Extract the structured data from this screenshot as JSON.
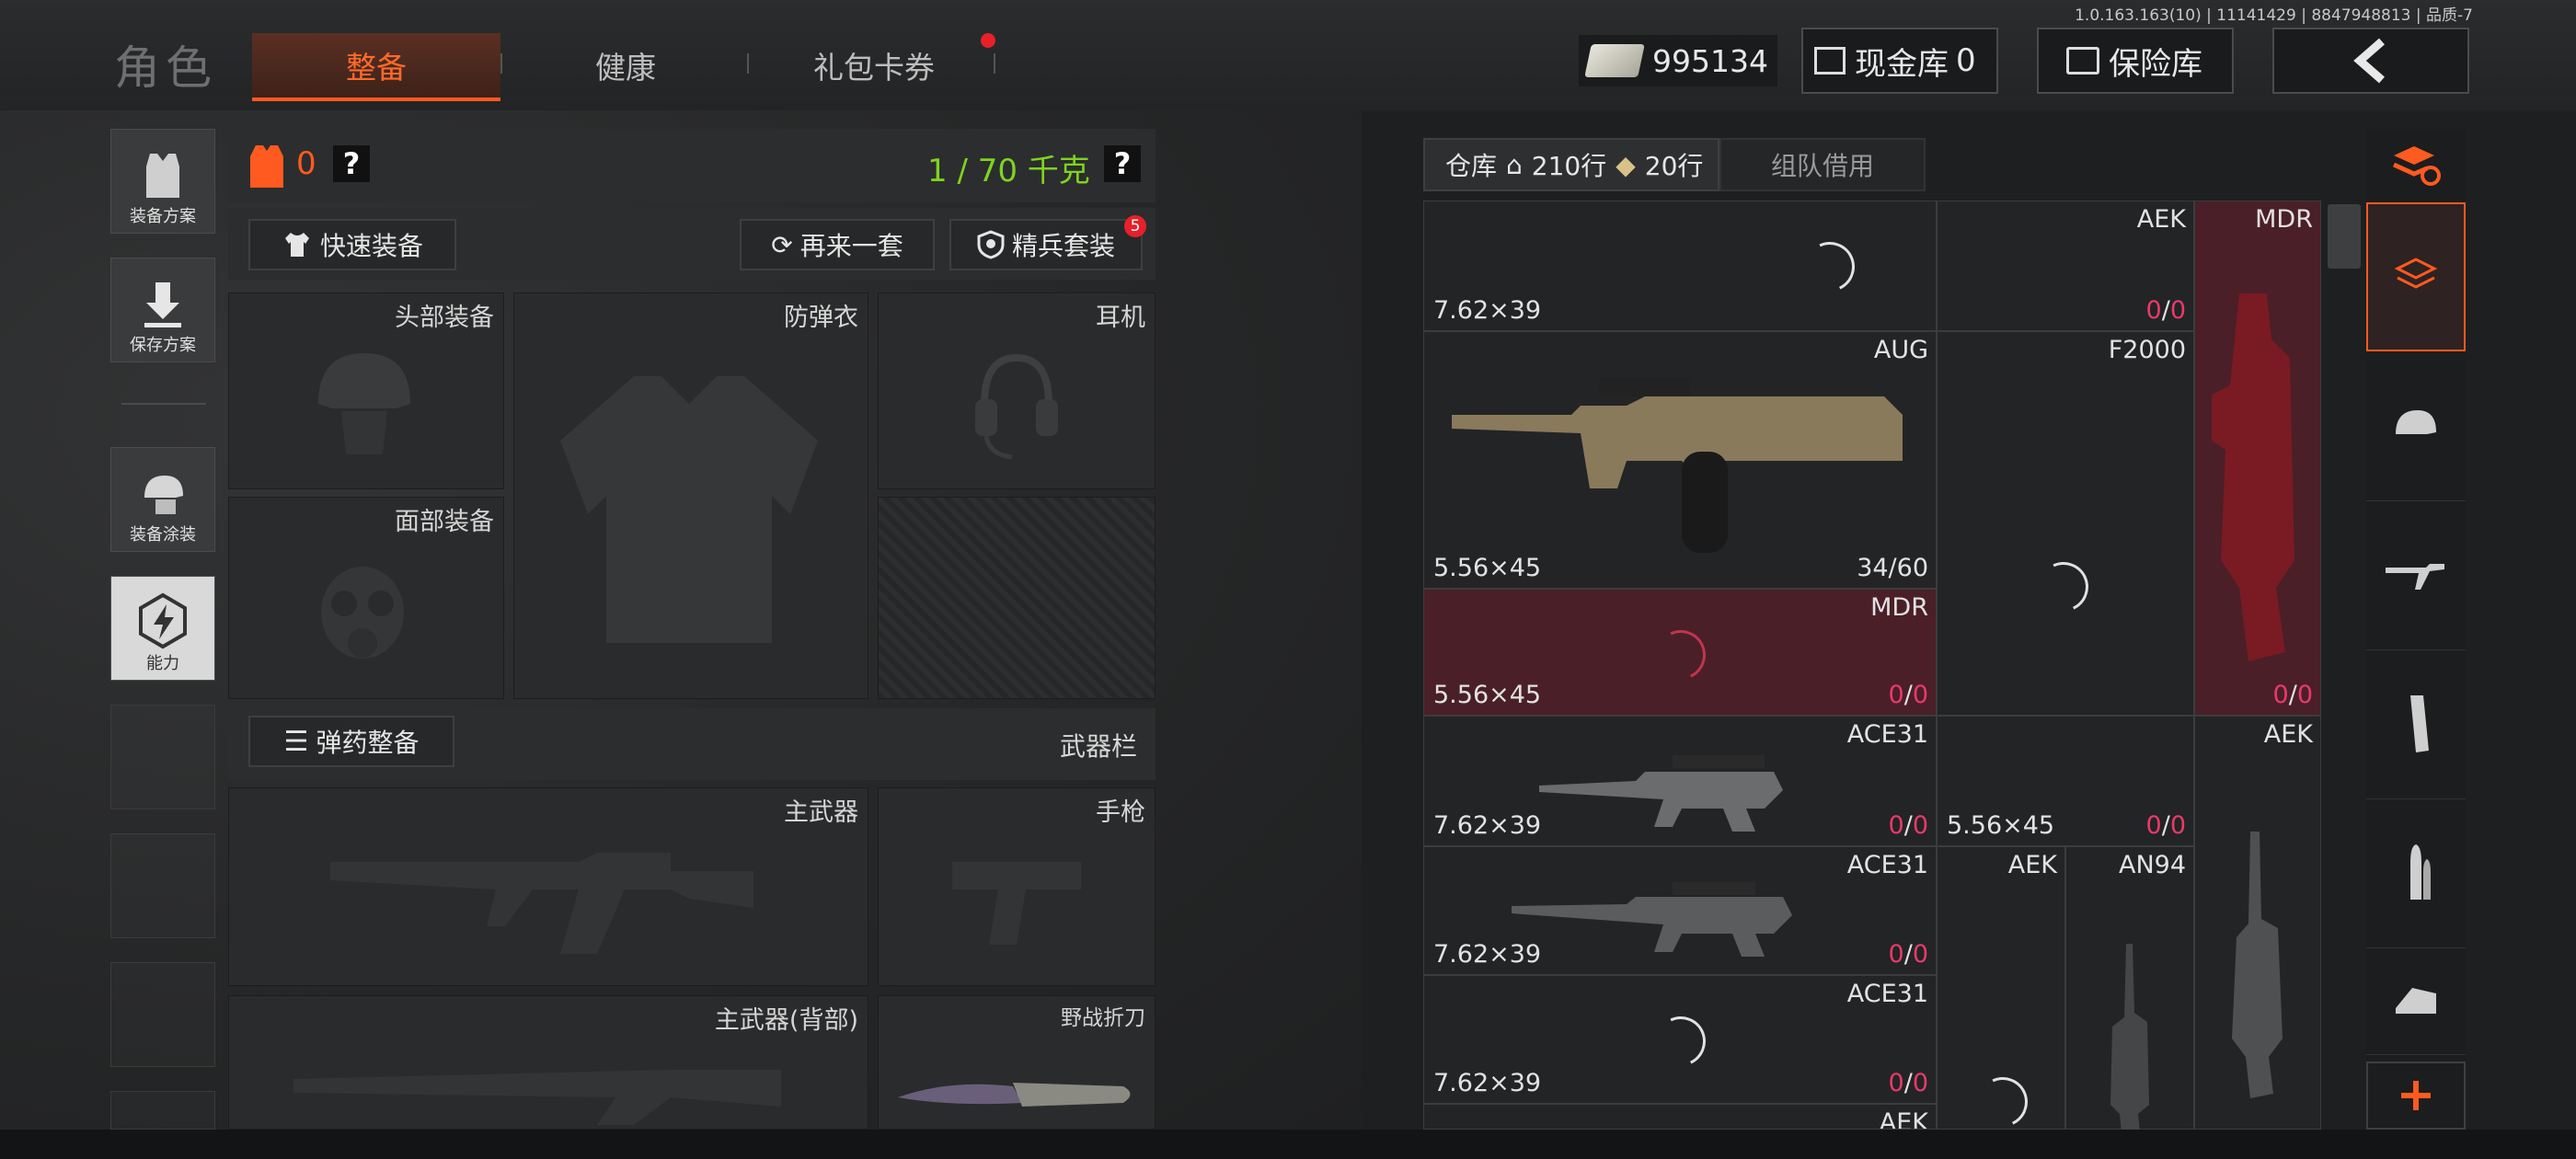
{
  "header": {
    "title": "角色",
    "tabs": [
      {
        "label": "整备",
        "active": true
      },
      {
        "label": "健康",
        "active": false
      },
      {
        "label": "礼包卡券",
        "active": false,
        "badge_dot": true
      }
    ],
    "version": "1.0.163.163(10) | 11141429 | 8847948813 | 品质-7",
    "currency": "995134",
    "cash_vault_label": "现金库",
    "cash_vault_value": "0",
    "insurance_label": "保险库"
  },
  "sidebar": {
    "buttons": [
      {
        "label": "装备方案",
        "icon": "armor-vest-icon"
      },
      {
        "label": "保存方案",
        "icon": "download-icon"
      },
      {
        "label": "装备涂装",
        "icon": "helmet-paint-icon"
      },
      {
        "label": "能力",
        "icon": "lightning-hex-icon"
      }
    ]
  },
  "loadout": {
    "value_count": "0",
    "help1": "?",
    "weight": "1 / 70 千克",
    "help2": "?",
    "quick_equip": "快速装备",
    "again": "再来一套",
    "elite": "精兵套装",
    "elite_badge": "5",
    "slots": {
      "head": "头部装备",
      "armor": "防弹衣",
      "ear": "耳机",
      "face": "面部装备"
    },
    "ammo_button": "弹药整备",
    "weapon_bar": "武器栏",
    "primary": "主武器",
    "pistol": "手枪",
    "primary_back": "主武器(背部)",
    "knife": "野战折刀"
  },
  "warehouse": {
    "tab_label": "仓库",
    "rows1": "210行",
    "rows2": "20行",
    "team_tab": "组队借用",
    "cells": [
      {
        "name": "",
        "caliber": "7.62×39",
        "dur": "",
        "dur_max": ""
      },
      {
        "name": "AEK",
        "caliber": "",
        "dur": "0",
        "dur_max": "0"
      },
      {
        "name": "MDR",
        "caliber": "",
        "dur": "0",
        "dur_max": "0"
      },
      {
        "name": "AUG",
        "caliber": "5.56×45",
        "dur": "34",
        "dur_max": "/60"
      },
      {
        "name": "F2000",
        "caliber": "",
        "dur": "",
        "dur_max": ""
      },
      {
        "name": "MDR",
        "caliber": "5.56×45",
        "dur": "0",
        "dur_max": "0"
      },
      {
        "name": "ACE31",
        "caliber": "7.62×39",
        "dur": "0",
        "dur_max": "0"
      },
      {
        "name": "",
        "caliber": "5.56×45",
        "dur": "0",
        "dur_max": "0"
      },
      {
        "name": "AEK",
        "caliber": "",
        "dur": "",
        "dur_max": ""
      },
      {
        "name": "ACE31",
        "caliber": "7.62×39",
        "dur": "0",
        "dur_max": "0"
      },
      {
        "name": "AEK",
        "caliber": "",
        "dur": "",
        "dur_max": ""
      },
      {
        "name": "AN94",
        "caliber": "",
        "dur": "",
        "dur_max": ""
      },
      {
        "name": "ACE31",
        "caliber": "7.62×39",
        "dur": "0",
        "dur_max": "0"
      },
      {
        "name": "AEK",
        "caliber": "",
        "dur": "",
        "dur_max": ""
      }
    ],
    "right_col_dur": "0"
  },
  "categories": [
    "layers-refresh-icon",
    "stack-icon",
    "helmet-icon",
    "rifle-icon",
    "magazine-icon",
    "bullet-icon",
    "scope-icon",
    "plus-icon"
  ],
  "colors": {
    "accent": "#ff5a1f",
    "green": "#7ed321",
    "red_cell": "#4a1f28"
  }
}
